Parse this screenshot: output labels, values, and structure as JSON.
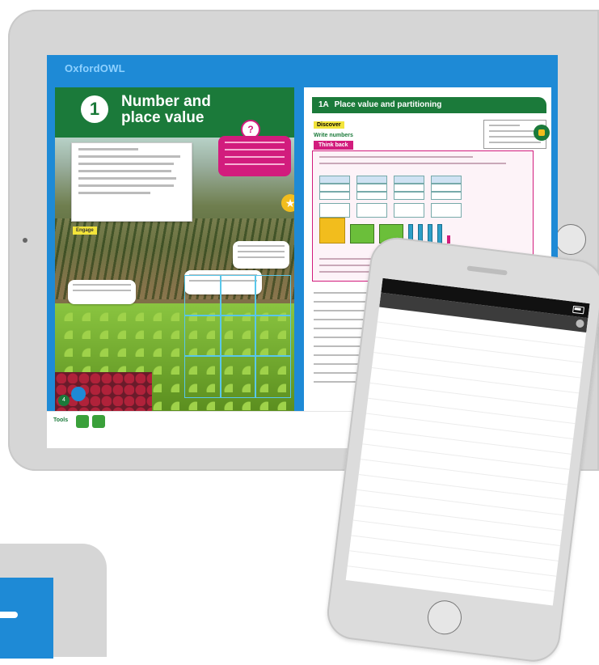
{
  "tablet": {
    "app_logo": "OxfordOWL",
    "left_page": {
      "chapter_number": "1",
      "chapter_title": "Number and place value",
      "engage_label": "Engage",
      "question_mark": "?"
    },
    "right_page": {
      "section_number": "1A",
      "section_title": "Place value and partitioning",
      "discover_label": "Discover",
      "write_numbers_label": "Write numbers",
      "think_back_label": "Think back"
    },
    "tools_label": "Tools"
  },
  "phone": {
    "toc": [
      {
        "label": "",
        "page": "",
        "header": true
      },
      {
        "label": "",
        "page": "",
        "header": true
      },
      {
        "label": "",
        "page": ""
      },
      {
        "label": "",
        "page": ""
      },
      {
        "label": "",
        "page": ""
      },
      {
        "label": "",
        "page": ""
      },
      {
        "label": "",
        "page": ""
      },
      {
        "label": "",
        "page": ""
      },
      {
        "label": "",
        "page": ""
      },
      {
        "label": "",
        "page": ""
      },
      {
        "label": "",
        "page": ""
      },
      {
        "label": "",
        "page": ""
      },
      {
        "label": "",
        "page": ""
      },
      {
        "label": "",
        "page": ""
      },
      {
        "label": "",
        "page": ""
      },
      {
        "label": "",
        "page": ""
      },
      {
        "label": "",
        "page": ""
      }
    ]
  },
  "colors": {
    "app_blue": "#1e8ad6",
    "chapter_green": "#1b7a3a",
    "question_pink": "#d21c7d",
    "highlight_yellow": "#f3e43a"
  },
  "icons": [
    "question-icon",
    "star-icon",
    "speaker-icon",
    "pencil-icon",
    "battery-icon",
    "menu-icon"
  ]
}
